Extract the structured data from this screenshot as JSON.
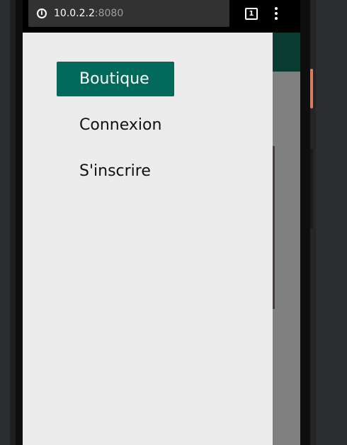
{
  "browser": {
    "url_host": "10.0.2.2",
    "url_port": ":8080",
    "tab_count": "1",
    "info_icon": "info-icon",
    "menu_icon": "more-vert-icon"
  },
  "colors": {
    "accent": "#026a5a",
    "header": "#0a3b32",
    "drawer_bg": "#ececec",
    "overlay": "#808080"
  },
  "drawer": {
    "items": [
      {
        "label": "Boutique",
        "active": true
      },
      {
        "label": "Connexion",
        "active": false
      },
      {
        "label": "S'inscrire",
        "active": false
      }
    ]
  }
}
